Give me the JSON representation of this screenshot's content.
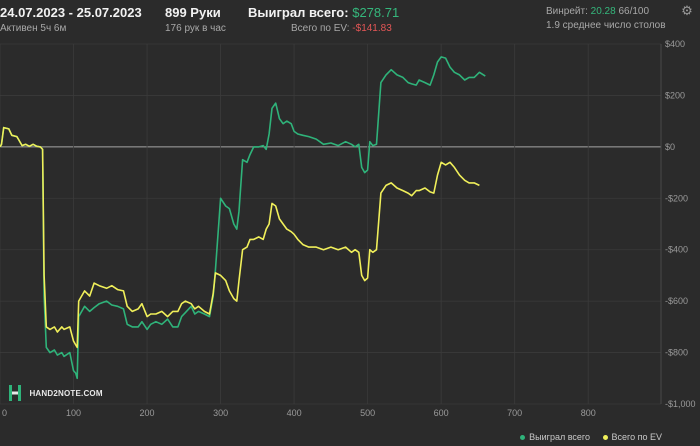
{
  "header": {
    "date_range": "24.07.2023 - 25.07.2023",
    "active": "Активен 5ч 6м",
    "hands": "899 Руки",
    "hands_per_hour": "176 рук в час",
    "won_label": "Выиграл всего:",
    "won_value": "$278.71",
    "ev_label": "Всего по EV:",
    "ev_value": "-$141.83",
    "winrate_label": "Винрейт:",
    "winrate_value": "20.28",
    "winrate_suffix": "66/100",
    "tables": "1.9 среднее число столов"
  },
  "logo": {
    "text": "HAND2NOTE.COM"
  },
  "colors": {
    "won": "#2fb37a",
    "ev": "#f0ef5a",
    "background": "#2b2b2b",
    "grid": "#3b3b3b",
    "zero": "#a6a6a6"
  },
  "icons": {
    "settings": "gear-icon"
  },
  "chart_data": {
    "type": "line",
    "xlim": [
      0,
      899
    ],
    "ylim": [
      -1000,
      400
    ],
    "xticks": [
      0,
      100,
      200,
      300,
      400,
      500,
      600,
      700,
      800
    ],
    "yticks": [
      400,
      200,
      0,
      -200,
      -400,
      -600,
      -800,
      -1000
    ],
    "ytick_labels": [
      "$400",
      "$200",
      "$0",
      "-$200",
      "-$400",
      "-$600",
      "-$800",
      "-$1,000"
    ],
    "legend": [
      "Выиграл всего",
      "Всего по EV"
    ],
    "legend_position": "bottom-right",
    "grid": true,
    "series": [
      {
        "name": "Выиграл всего",
        "color": "#2fb37a",
        "points": [
          [
            0,
            0
          ],
          [
            2,
            10
          ],
          [
            5,
            75
          ],
          [
            12,
            70
          ],
          [
            16,
            45
          ],
          [
            23,
            40
          ],
          [
            30,
            5
          ],
          [
            35,
            10
          ],
          [
            40,
            2
          ],
          [
            45,
            10
          ],
          [
            50,
            2
          ],
          [
            55,
            0
          ],
          [
            58,
            -10
          ],
          [
            60,
            -580
          ],
          [
            63,
            -780
          ],
          [
            68,
            -800
          ],
          [
            74,
            -790
          ],
          [
            78,
            -810
          ],
          [
            84,
            -800
          ],
          [
            87,
            -815
          ],
          [
            95,
            -800
          ],
          [
            100,
            -870
          ],
          [
            103,
            -880
          ],
          [
            105,
            -900
          ],
          [
            107,
            -660
          ],
          [
            115,
            -620
          ],
          [
            122,
            -640
          ],
          [
            128,
            -625
          ],
          [
            135,
            -610
          ],
          [
            145,
            -600
          ],
          [
            152,
            -615
          ],
          [
            160,
            -620
          ],
          [
            168,
            -630
          ],
          [
            173,
            -690
          ],
          [
            180,
            -700
          ],
          [
            188,
            -700
          ],
          [
            193,
            -680
          ],
          [
            200,
            -710
          ],
          [
            205,
            -690
          ],
          [
            212,
            -680
          ],
          [
            220,
            -690
          ],
          [
            228,
            -670
          ],
          [
            235,
            -700
          ],
          [
            242,
            -700
          ],
          [
            247,
            -660
          ],
          [
            252,
            -645
          ],
          [
            260,
            -620
          ],
          [
            265,
            -650
          ],
          [
            270,
            -640
          ],
          [
            278,
            -650
          ],
          [
            285,
            -660
          ],
          [
            290,
            -580
          ],
          [
            293,
            -480
          ],
          [
            300,
            -200
          ],
          [
            307,
            -230
          ],
          [
            312,
            -240
          ],
          [
            318,
            -300
          ],
          [
            322,
            -320
          ],
          [
            325,
            -250
          ],
          [
            330,
            -50
          ],
          [
            336,
            -60
          ],
          [
            340,
            -30
          ],
          [
            345,
            0
          ],
          [
            352,
            0
          ],
          [
            358,
            5
          ],
          [
            362,
            -10
          ],
          [
            366,
            50
          ],
          [
            370,
            150
          ],
          [
            375,
            170
          ],
          [
            380,
            110
          ],
          [
            385,
            90
          ],
          [
            390,
            100
          ],
          [
            396,
            90
          ],
          [
            400,
            60
          ],
          [
            405,
            50
          ],
          [
            412,
            45
          ],
          [
            420,
            40
          ],
          [
            430,
            30
          ],
          [
            440,
            10
          ],
          [
            450,
            15
          ],
          [
            460,
            5
          ],
          [
            470,
            20
          ],
          [
            478,
            10
          ],
          [
            483,
            0
          ],
          [
            488,
            10
          ],
          [
            492,
            -80
          ],
          [
            496,
            -100
          ],
          [
            500,
            -90
          ],
          [
            503,
            20
          ],
          [
            507,
            5
          ],
          [
            512,
            10
          ],
          [
            518,
            250
          ],
          [
            525,
            280
          ],
          [
            532,
            300
          ],
          [
            540,
            280
          ],
          [
            548,
            270
          ],
          [
            555,
            250
          ],
          [
            560,
            245
          ],
          [
            566,
            240
          ],
          [
            570,
            260
          ],
          [
            578,
            250
          ],
          [
            585,
            240
          ],
          [
            590,
            280
          ],
          [
            595,
            330
          ],
          [
            600,
            350
          ],
          [
            606,
            345
          ],
          [
            612,
            310
          ],
          [
            618,
            290
          ],
          [
            625,
            280
          ],
          [
            632,
            260
          ],
          [
            638,
            270
          ],
          [
            645,
            270
          ],
          [
            652,
            290
          ],
          [
            660,
            275
          ]
        ],
        "sample_note": "full path"
      },
      {
        "name": "Всего по EV",
        "color": "#f0ef5a",
        "points": [
          [
            0,
            0
          ],
          [
            2,
            10
          ],
          [
            5,
            75
          ],
          [
            12,
            70
          ],
          [
            16,
            45
          ],
          [
            23,
            40
          ],
          [
            30,
            5
          ],
          [
            35,
            10
          ],
          [
            40,
            2
          ],
          [
            45,
            10
          ],
          [
            50,
            2
          ],
          [
            55,
            0
          ],
          [
            58,
            -10
          ],
          [
            60,
            -500
          ],
          [
            63,
            -700
          ],
          [
            68,
            -710
          ],
          [
            74,
            -700
          ],
          [
            78,
            -720
          ],
          [
            84,
            -700
          ],
          [
            87,
            -710
          ],
          [
            95,
            -700
          ],
          [
            100,
            -755
          ],
          [
            103,
            -770
          ],
          [
            105,
            -780
          ],
          [
            107,
            -600
          ],
          [
            115,
            -560
          ],
          [
            122,
            -580
          ],
          [
            128,
            -530
          ],
          [
            135,
            -540
          ],
          [
            145,
            -550
          ],
          [
            152,
            -540
          ],
          [
            160,
            -555
          ],
          [
            168,
            -560
          ],
          [
            173,
            -620
          ],
          [
            180,
            -640
          ],
          [
            188,
            -630
          ],
          [
            193,
            -610
          ],
          [
            200,
            -660
          ],
          [
            205,
            -650
          ],
          [
            212,
            -650
          ],
          [
            220,
            -640
          ],
          [
            228,
            -660
          ],
          [
            235,
            -640
          ],
          [
            242,
            -640
          ],
          [
            247,
            -610
          ],
          [
            252,
            -600
          ],
          [
            260,
            -610
          ],
          [
            265,
            -630
          ],
          [
            270,
            -620
          ],
          [
            278,
            -640
          ],
          [
            285,
            -650
          ],
          [
            290,
            -570
          ],
          [
            293,
            -490
          ],
          [
            300,
            -500
          ],
          [
            307,
            -520
          ],
          [
            312,
            -560
          ],
          [
            318,
            -590
          ],
          [
            322,
            -600
          ],
          [
            325,
            -520
          ],
          [
            330,
            -400
          ],
          [
            336,
            -390
          ],
          [
            340,
            -360
          ],
          [
            345,
            -360
          ],
          [
            352,
            -350
          ],
          [
            358,
            -360
          ],
          [
            362,
            -320
          ],
          [
            366,
            -300
          ],
          [
            370,
            -220
          ],
          [
            375,
            -230
          ],
          [
            380,
            -280
          ],
          [
            385,
            -300
          ],
          [
            390,
            -320
          ],
          [
            396,
            -330
          ],
          [
            400,
            -340
          ],
          [
            405,
            -360
          ],
          [
            412,
            -380
          ],
          [
            420,
            -390
          ],
          [
            430,
            -390
          ],
          [
            440,
            -400
          ],
          [
            450,
            -390
          ],
          [
            460,
            -400
          ],
          [
            470,
            -390
          ],
          [
            478,
            -410
          ],
          [
            483,
            -400
          ],
          [
            488,
            -410
          ],
          [
            492,
            -500
          ],
          [
            496,
            -520
          ],
          [
            500,
            -510
          ],
          [
            503,
            -400
          ],
          [
            507,
            -410
          ],
          [
            512,
            -400
          ],
          [
            518,
            -180
          ],
          [
            525,
            -150
          ],
          [
            532,
            -140
          ],
          [
            540,
            -160
          ],
          [
            548,
            -170
          ],
          [
            555,
            -180
          ],
          [
            560,
            -190
          ],
          [
            566,
            -170
          ],
          [
            570,
            -170
          ],
          [
            578,
            -160
          ],
          [
            585,
            -175
          ],
          [
            590,
            -180
          ],
          [
            595,
            -110
          ],
          [
            600,
            -60
          ],
          [
            606,
            -70
          ],
          [
            612,
            -60
          ],
          [
            618,
            -80
          ],
          [
            625,
            -110
          ],
          [
            632,
            -130
          ],
          [
            638,
            -140
          ],
          [
            645,
            -140
          ],
          [
            652,
            -150
          ]
        ],
        "sample_note": "full path"
      }
    ]
  }
}
